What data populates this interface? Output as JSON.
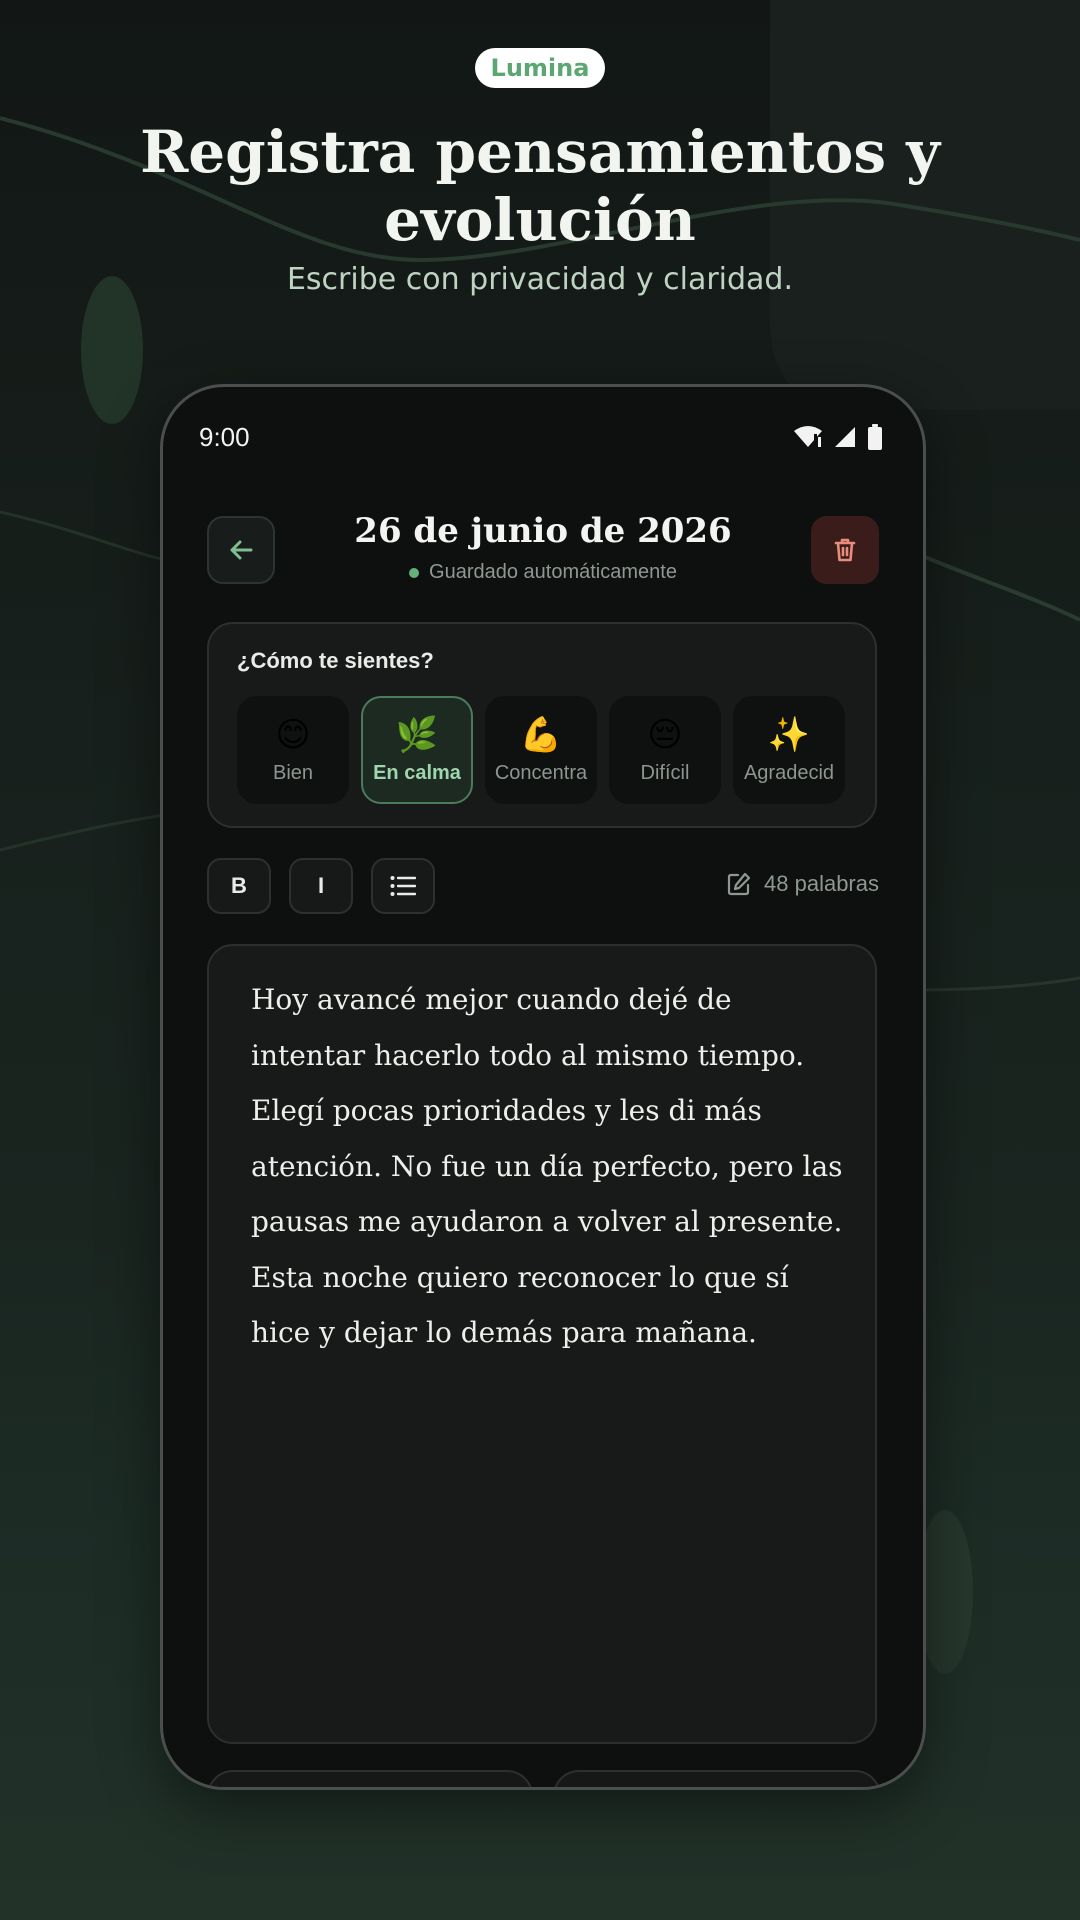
{
  "app_name": "Lumina",
  "headline": "Registra pensamientos y evolución",
  "subheadline": "Escribe con privacidad y claridad.",
  "status_bar": {
    "time": "9:00"
  },
  "entry": {
    "date": "26 de junio de 2026",
    "save_status": "Guardado automáticamente"
  },
  "mood_section": {
    "title": "¿Cómo te sientes?",
    "options": [
      {
        "emoji": "😊",
        "label": "Bien",
        "selected": false
      },
      {
        "emoji": "🌿",
        "label": "En calma",
        "selected": true
      },
      {
        "emoji": "💪",
        "label": "Concentra",
        "selected": false
      },
      {
        "emoji": "😔",
        "label": "Difícil",
        "selected": false
      },
      {
        "emoji": "✨",
        "label": "Agradecid",
        "selected": false
      }
    ]
  },
  "toolbar": {
    "bold_label": "B",
    "italic_label": "I",
    "list_icon": "list-icon",
    "word_count": "48 palabras"
  },
  "editor": {
    "text": "Hoy avancé mejor cuando dejé de intentar hacerlo todo al mismo tiempo. Elegí pocas prioridades y les di más atención. No fue un día perfecto, pero las pausas me ayudaron a volver al presente. Esta noche quiero reconocer lo que sí hice y dejar lo demás para mañana."
  },
  "icons": {
    "back": "arrow-left-icon",
    "delete": "trash-icon",
    "word_count": "edit-icon",
    "status": [
      "wifi-icon",
      "signal-icon",
      "battery-icon"
    ]
  },
  "colors": {
    "accent": "#66b07c",
    "danger_bg": "#3a1d1b",
    "danger_icon": "#e98c7c",
    "card_bg": "#171a19",
    "phone_bg": "#0e100f"
  }
}
